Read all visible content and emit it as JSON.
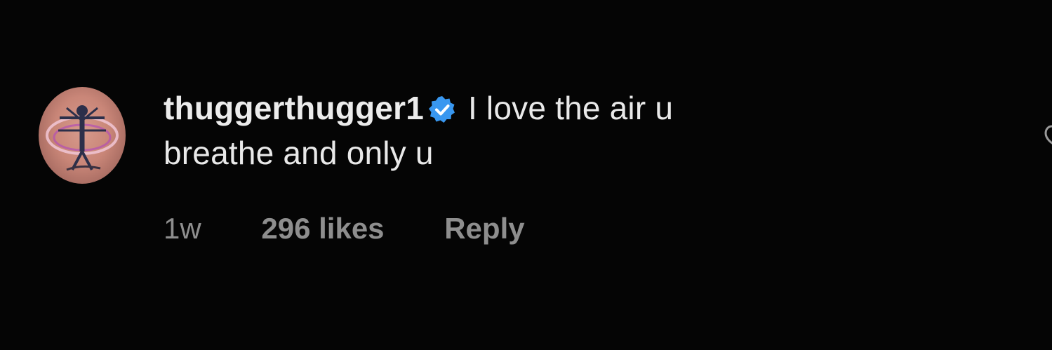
{
  "comment": {
    "username": "thuggerthugger1",
    "verified": true,
    "text_line1": " I love the air u",
    "text_line2": "breathe and only u",
    "time": "1w",
    "likes": "296 likes",
    "reply_label": "Reply"
  },
  "icons": {
    "avatar": "profile-avatar",
    "verified": "verified-badge-icon",
    "like": "heart-outline-icon"
  },
  "colors": {
    "background": "#050505",
    "text": "#e9e9e9",
    "meta": "#8e8e8e",
    "verified_blue": "#3897f0"
  }
}
